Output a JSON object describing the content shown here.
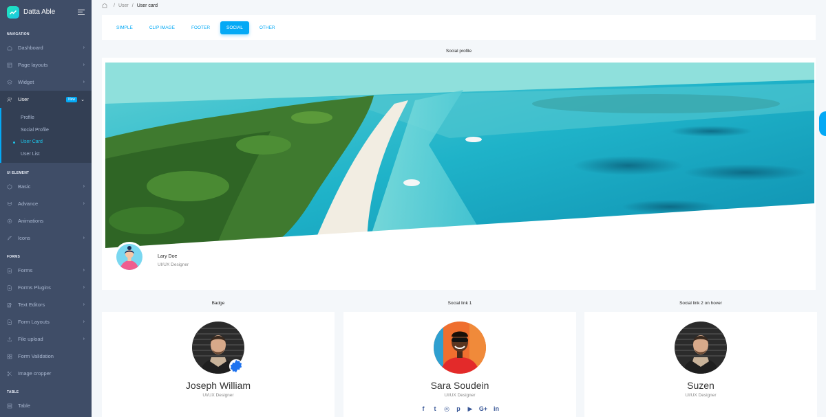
{
  "brand": {
    "name": "Datta Able"
  },
  "sidebar": {
    "captions": {
      "navigation": "NAVIGATION",
      "ui_element": "UI ELEMENT",
      "forms": "FORMS",
      "table": "TABLE"
    },
    "nav": [
      {
        "label": "Dashboard",
        "icon": "home-icon"
      },
      {
        "label": "Page layouts",
        "icon": "layout-icon"
      },
      {
        "label": "Widget",
        "icon": "layers-icon"
      },
      {
        "label": "User",
        "icon": "users-icon",
        "badge": "New"
      }
    ],
    "user_sub": [
      "Profile",
      "Social Profile",
      "User Card",
      "User List"
    ],
    "ui": [
      {
        "label": "Basic",
        "icon": "box-icon"
      },
      {
        "label": "Advance",
        "icon": "gitlab-icon"
      },
      {
        "label": "Animations",
        "icon": "aperture-icon"
      },
      {
        "label": "Icons",
        "icon": "feather-icon"
      }
    ],
    "forms": [
      {
        "label": "Forms",
        "icon": "file-text-icon"
      },
      {
        "label": "Forms Plugins",
        "icon": "file-plus-icon"
      },
      {
        "label": "Text Editors",
        "icon": "edit-icon"
      },
      {
        "label": "Form Layouts",
        "icon": "file-minus-icon"
      },
      {
        "label": "File upload",
        "icon": "upload-icon"
      },
      {
        "label": "Form Validation",
        "icon": "grid-icon"
      },
      {
        "label": "Image cropper",
        "icon": "scissors-icon"
      }
    ],
    "table": [
      {
        "label": "Table",
        "icon": "server-icon"
      }
    ]
  },
  "breadcrumb": {
    "parent": "User",
    "current": "User card",
    "separator": "/"
  },
  "tabs": [
    "SIMPLE",
    "CLIP IMAGE",
    "FOOTER",
    "SOCIAL",
    "OTHER"
  ],
  "profile_section": {
    "title": "Social profile",
    "name": "Lary Doe",
    "role": "UI/UX Designer"
  },
  "cards_titles": [
    "Badge",
    "Social link 1",
    "Social link 2 on hover"
  ],
  "cards": [
    {
      "name": "Joseph William",
      "role": "UI/UX Designer"
    },
    {
      "name": "Sara Soudein",
      "role": "UI/UX Designer"
    },
    {
      "name": "Suzen",
      "role": "UI/UX Designer"
    }
  ],
  "social_icons": [
    "f",
    "t",
    "◎",
    "p",
    "▶",
    "G+",
    "in"
  ],
  "colors": {
    "primary": "#04a9f5",
    "sidebar": "#3f4d67",
    "accent": "#1dc4e9"
  }
}
